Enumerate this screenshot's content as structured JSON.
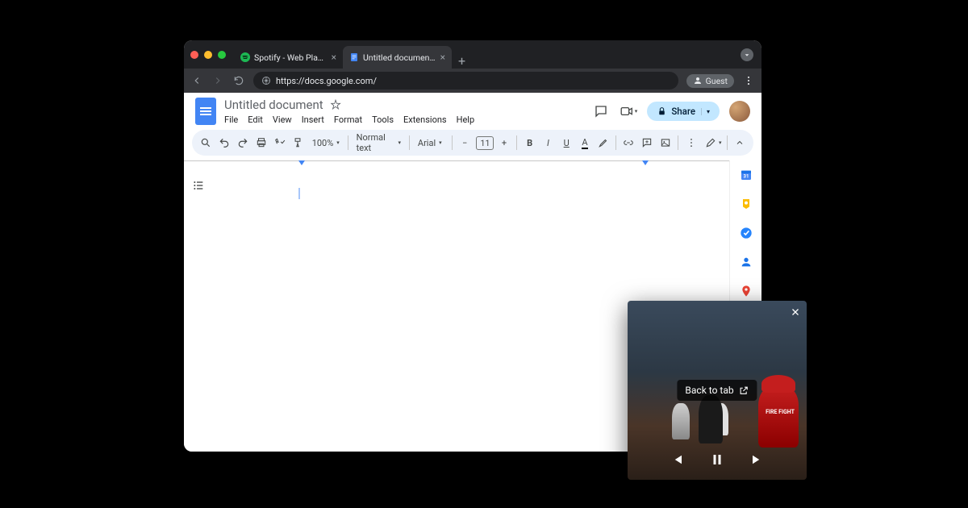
{
  "browser": {
    "tabs": [
      {
        "title": "Spotify - Web Player: Music f",
        "favicon": "spotify"
      },
      {
        "title": "Untitled document - Google D",
        "favicon": "docs"
      }
    ],
    "url": "https://docs.google.com/",
    "profile_label": "Guest"
  },
  "docs": {
    "title": "Untitled document",
    "menus": [
      "File",
      "Edit",
      "View",
      "Insert",
      "Format",
      "Tools",
      "Extensions",
      "Help"
    ],
    "share_label": "Share",
    "toolbar": {
      "zoom": "100%",
      "style": "Normal text",
      "font": "Arial",
      "font_size": "11"
    }
  },
  "pip": {
    "back_label": "Back to tab",
    "jacket_text": "FIRE\nFIGHT"
  }
}
